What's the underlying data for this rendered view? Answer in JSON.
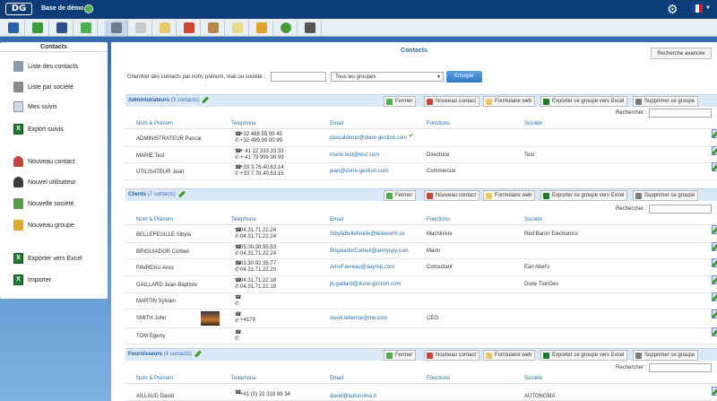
{
  "app": {
    "logo": "DG",
    "title": "Base de démo"
  },
  "toolbar": {
    "icons": [
      "dashboard-icon",
      "contacts-icon",
      "save-icon",
      "spreadsheet-icon",
      "contacts-active-icon",
      "mail-icon",
      "document-icon",
      "house-icon",
      "boxes-icon",
      "notes-icon",
      "coins-icon",
      "globe-icon",
      "media-icon"
    ]
  },
  "sidebar": {
    "title": "Contacts",
    "items": [
      {
        "label": "Liste des contacts",
        "icon": "contact-list-icon"
      },
      {
        "label": "Liste par société",
        "icon": "company-list-icon"
      },
      {
        "label": "Mes suivis",
        "icon": "followup-icon"
      },
      {
        "label": "Export suivis",
        "icon": "excel-icon"
      },
      {
        "label": "Nouveau contact",
        "icon": "new-contact-icon"
      },
      {
        "label": "Nouvel utilisateur",
        "icon": "new-user-icon"
      },
      {
        "label": "Nouvelle société",
        "icon": "new-company-icon"
      },
      {
        "label": "Nouveau groupe",
        "icon": "new-group-icon"
      },
      {
        "label": "Exporter vers Excel",
        "icon": "excel-icon"
      },
      {
        "label": "Importer",
        "icon": "import-icon"
      }
    ]
  },
  "main": {
    "title": "Contacts",
    "advanced_search": "Recherche avancée",
    "search_label": "Chercher des contacts par nom, prénom, mail ou société :",
    "group_select": "Tous les groupes",
    "send_button": "Envoyer",
    "search_label2": "Rechercher :",
    "columns": {
      "name": "Nom & Prénom",
      "tel": "Telephone",
      "email": "Email",
      "fn": "Fonctions",
      "co": "Société"
    },
    "buttons": {
      "close": "Fermer",
      "new_contact": "Nouveau contact",
      "web_form": "Formulaire web",
      "export": "Exporter ce groupe vers Excel",
      "delete": "Supprimer ce groupe"
    },
    "groups": [
      {
        "name": "Administrateurs",
        "count": "(3 contacts)",
        "rows": [
          {
            "name": "ADMINISTRATEUR Pascal",
            "tel1": "+32 488 55 99 45",
            "tel2": "+32 499 99 00 99",
            "email": "pascaldemo@dune-gestion.com",
            "fn": "",
            "co": "",
            "acts": "ppl-stop"
          },
          {
            "name": "MARIE Test",
            "tel1": "+ 41 22 333 33 33",
            "tel2": "+ 41 79 999 99 99",
            "email": "marie.test@test.com",
            "fn": "Directrice",
            "co": "Test",
            "acts": "stop"
          },
          {
            "name": "UTILISATEUR Jean",
            "tel1": "+33 3.76.40.63.14",
            "tel2": "+33 7.76.40.63.15",
            "email": "jean@dune-gestion.com",
            "fn": "Commercial",
            "co": "",
            "acts": "ppl-stop"
          }
        ]
      },
      {
        "name": "Clients",
        "count": "(7 contacts)",
        "rows": [
          {
            "name": "BELLEFEUILLE Sibyla",
            "tel1": "04.31.71.22.24",
            "tel2": "04.31.71.22.24",
            "email": "SibylaBellefeuille@teleworm.us",
            "fn": "Machiniste",
            "co": "Red Baron Electronics"
          },
          {
            "name": "BRIGUIADOR Corbeil",
            "tel1": "05.00.38.95.53",
            "tel2": "04.31.71.22.24",
            "email": "BriguiadorCorbeil@armyspy.com",
            "fn": "Marin",
            "co": ""
          },
          {
            "name": "FAVREAU Arno",
            "tel1": "03.30.92.38.77",
            "tel2": "04.31.71.22.20",
            "email": "ArnoFavreau@dayrep.com",
            "fn": "Consultant",
            "co": "Earl Abel's"
          },
          {
            "name": "GAILLARD Jean-Baptiste",
            "tel1": "04.31.71.22.18",
            "tel2": "04.31.71.22.18",
            "email": "jb.gaillard@dune-gestion.com",
            "fn": "",
            "co": "Dune TionGes"
          },
          {
            "name": "MARTIN Sylvain",
            "tel1": "",
            "tel2": "",
            "email": "",
            "fn": "",
            "co": ""
          },
          {
            "name": "SMITH John",
            "tel1": "",
            "tel2": "+4179",
            "email": "david.tellenne@me.com",
            "fn": "CEO",
            "co": ""
          },
          {
            "name": "TOM Egerry",
            "tel1": "",
            "tel2": "",
            "email": "",
            "fn": "",
            "co": ""
          }
        ]
      },
      {
        "name": "Fournisseurs",
        "count": "(4 contacts)",
        "rows": [
          {
            "name": "AILLAUD David",
            "tel1": "+41 (0) 22 318 98 34",
            "tel2": "",
            "email": "david@autonoma.fr",
            "fn": "",
            "co": "AUTONOMA"
          }
        ]
      }
    ]
  }
}
